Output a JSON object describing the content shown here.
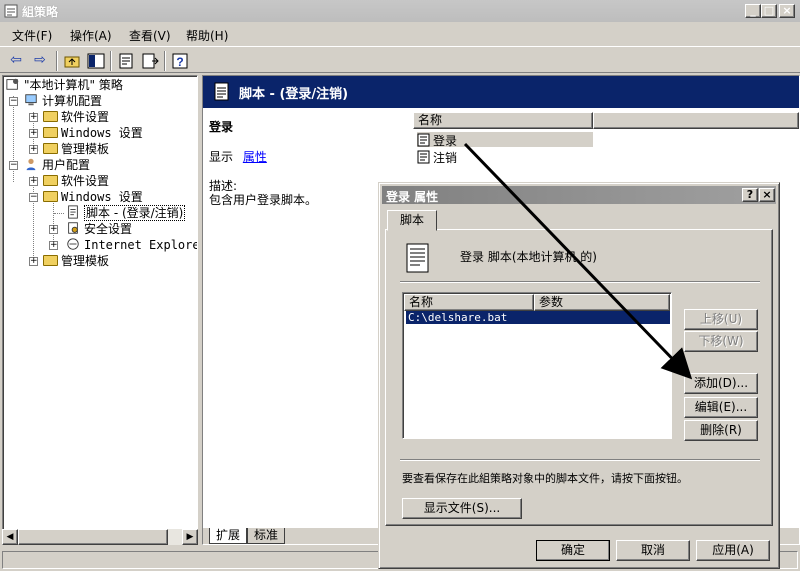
{
  "window": {
    "title": "組策略",
    "min_glyph": "_",
    "max_glyph": "□",
    "close_glyph": "×"
  },
  "menu": [
    {
      "label": "文件(F)"
    },
    {
      "label": "操作(A)"
    },
    {
      "label": "查看(V)"
    },
    {
      "label": "帮助(H)"
    }
  ],
  "toolbar": {
    "back_glyph": "⇦",
    "forward_glyph": "⇨",
    "icons": [
      "back-arrow-icon",
      "forward-arrow-icon",
      "up-folder-icon",
      "show-hide-tree-icon",
      "properties-icon",
      "export-list-icon",
      "help-icon"
    ]
  },
  "tree": {
    "root": "\"本地计算机\" 策略",
    "computer_config": "计算机配置",
    "software_settings_1": "软件设置",
    "windows_settings_1": "Windows 设置",
    "admin_templates_1": "管理模板",
    "user_config": "用户配置",
    "software_settings_2": "软件设置",
    "windows_settings_2": "Windows 设置",
    "scripts": "脚本 - (登录/注销)",
    "security_settings": "安全设置",
    "ie": "Internet Explorer 维",
    "admin_templates_2": "管理模板"
  },
  "right_pane": {
    "header_title": "脚本 - (登录/注销)",
    "section_title": "登录",
    "show_prefix": "显示",
    "properties_link": "属性",
    "desc_label": "描述:",
    "desc_text": "包含用户登录脚本。",
    "col_name": "名称",
    "items": [
      "登录",
      "注销"
    ]
  },
  "bottom_tabs": {
    "extended": "扩展",
    "standard": "标准"
  },
  "dialog": {
    "title": "登录 属性",
    "help_glyph": "?",
    "close_glyph": "×",
    "tab": "脚本",
    "heading": "登录 脚本(本地计算机 的)",
    "col_name": "名称",
    "col_params": "参数",
    "scripts": [
      "C:\\delshare.bat"
    ],
    "btn_up": "上移(U)",
    "btn_down": "下移(W)",
    "btn_add": "添加(D)...",
    "btn_edit": "编辑(E)...",
    "btn_remove": "删除(R)",
    "info_text": "要查看保存在此組策略对象中的脚本文件，请按下面按钮。",
    "btn_show_files": "显示文件(S)...",
    "btn_ok": "确定",
    "btn_cancel": "取消",
    "btn_apply": "应用(A)"
  },
  "colors": {
    "header_bg": "#0a246a",
    "selection": "#0a246a",
    "link": "#0000ff"
  }
}
